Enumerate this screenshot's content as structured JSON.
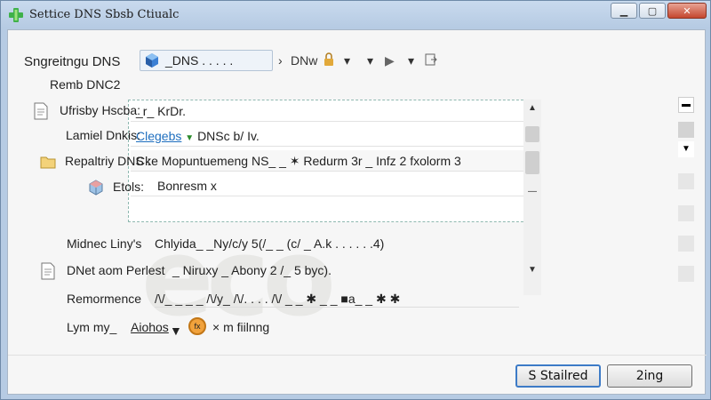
{
  "window": {
    "title": "Settice DNS Sbsb Ctiualc",
    "minimize": "▁",
    "maximize": "▢",
    "close": "✕"
  },
  "toolbar": {
    "label": "Sngreitngu DNS",
    "combo_value": "_DNS . . . . .",
    "item_dnw": "DNw",
    "item_arrow1": "▾",
    "item_arrow2": "▾",
    "item_play": "▶",
    "item_arrow3": "▾"
  },
  "section": {
    "title": "Remb DNC2"
  },
  "rows": [
    {
      "label": "Ufrisby Hscba:",
      "value": "_r_ KrDr."
    },
    {
      "label": "Lamiel Dnkis:",
      "value_link": "Clegebs",
      "value_rest": "DNSc b/ Iv."
    },
    {
      "label": "Repaltriy DNS :",
      "value": "Cke Mopuntuemeng NS_ _ ✶ Redurm 3r _ Infz 2 fxolorm 3"
    },
    {
      "label": "Etols:",
      "value": "Bonresm x"
    },
    {
      "label": "Midnec Liny's",
      "value": "Chlyida_ _Ny/c/y 5(/_ _ (c/ _ A.k . . . . . .4)"
    },
    {
      "label": "DNet aom Perlest",
      "value": "_ Niruxy _ Abony 2 /_ 5 byc)."
    },
    {
      "label": "Remormence",
      "value": "/\\/_ _ _ _ /\\/y_ /\\/. . . . /\\/ _ _ ✱ _ _ ■a_ _ ✱ ✱"
    },
    {
      "label": "Lym my_",
      "value_link": "Aiohos",
      "value_rest": "× m fiilnng",
      "badge": "fx"
    }
  ],
  "buttons": {
    "primary": "S Stailred",
    "secondary": "2ing"
  },
  "colors": {
    "accent": "#3d7bc7",
    "link": "#1f6fbf",
    "close": "#c4472f"
  },
  "icons": {
    "title": "shield-plus-icon",
    "combo": "globe-cube-icon",
    "doc": "document-icon",
    "folder": "folder-icon",
    "cube": "cube-icon",
    "badge": "orange-circle-icon"
  }
}
